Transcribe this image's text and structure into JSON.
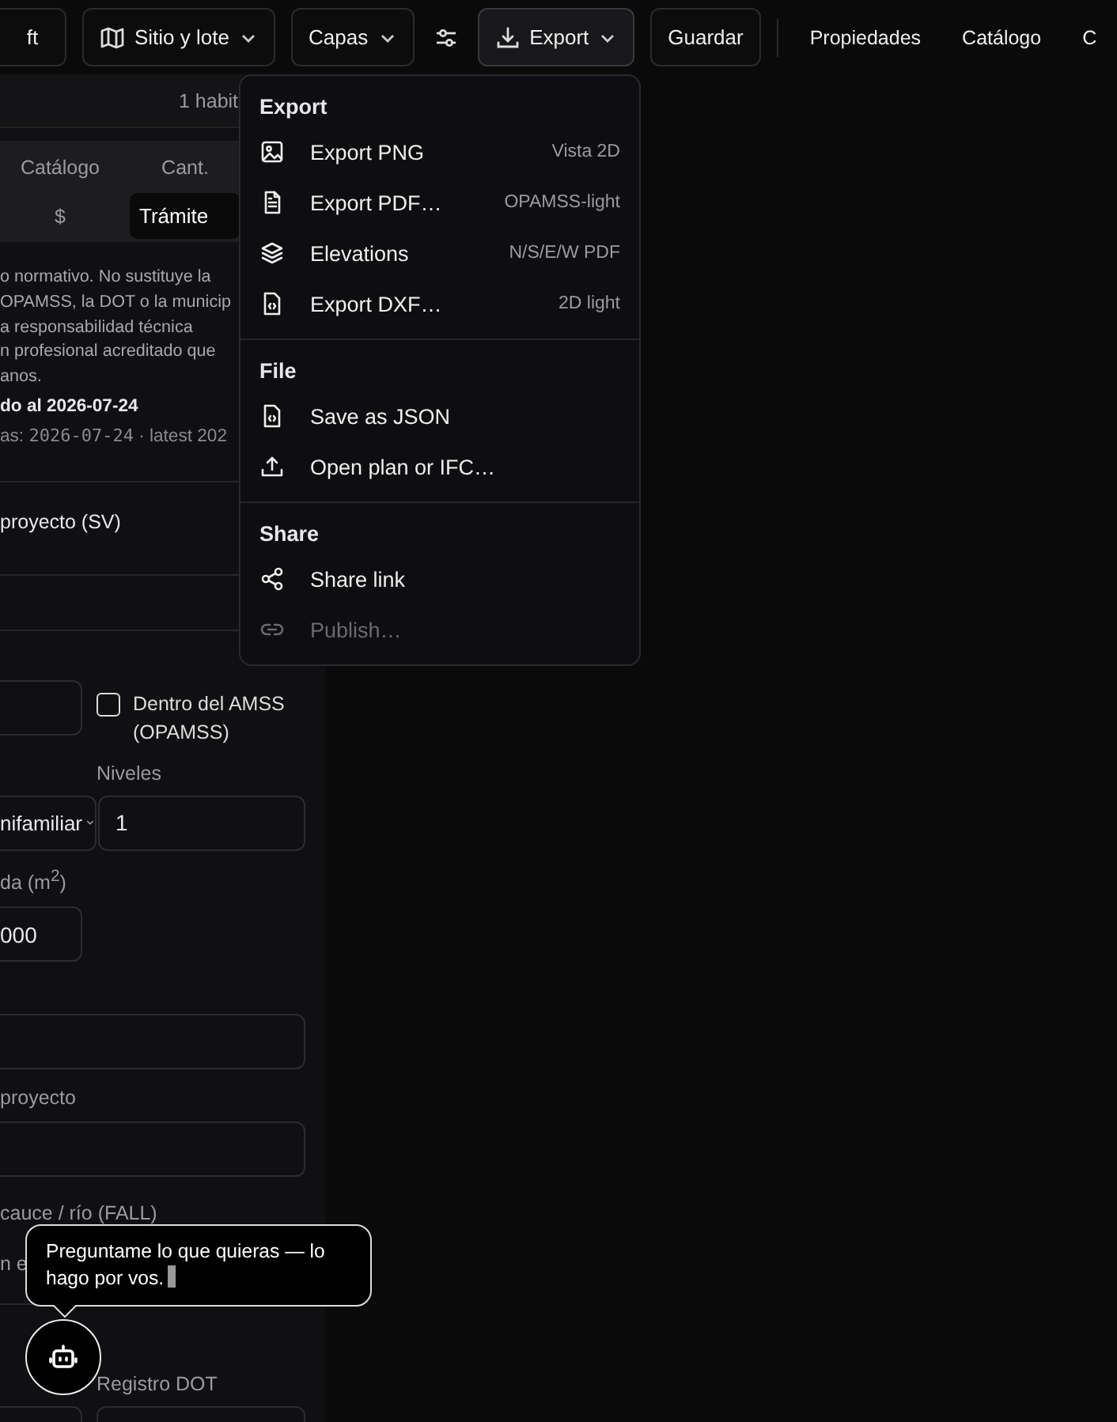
{
  "toolbar": {
    "items": [
      {
        "kind": "button",
        "label": "ft"
      },
      {
        "kind": "map-menu",
        "label": "Sitio y lote"
      },
      {
        "kind": "menu",
        "label": "Capas"
      },
      {
        "kind": "sliders"
      },
      {
        "kind": "export-menu",
        "label": "Export",
        "expanded": true
      },
      {
        "kind": "button",
        "label": "Guardar"
      }
    ],
    "links": [
      {
        "label": "Propiedades"
      },
      {
        "label": "Catálogo"
      },
      {
        "label": "C"
      }
    ]
  },
  "panel": {
    "summary": "1 habit",
    "tabs": [
      {
        "label": "Catálogo",
        "selected": false
      },
      {
        "label": "Cant.",
        "selected": false
      },
      {
        "label": "$",
        "selected": false
      },
      {
        "label": "Trámite",
        "selected": true
      }
    ],
    "notice": "o normativo. No sustituye la\nOPAMSS, la DOT o la municip\na responsabilidad técnica\nn profesional acreditado que\nanos.",
    "updated": "do al 2026-07-24",
    "dates_label": "as:",
    "dates_value": "2026-07-24",
    "dates_tail": "· latest 202",
    "section": "proyecto (SV)",
    "opamss": {
      "label": "Dentro del AMSS (OPAMSS)",
      "checked": false
    },
    "levels_label": "Niveles",
    "use_value": "nifamiliar",
    "levels_value": "1",
    "area_label": "da (m$^{2}$)",
    "area_value": "000",
    "project_label": "proyecto",
    "river_label": "cauce / río (FALL)",
    "cut_label": "n e",
    "dot_label": "Registro DOT"
  },
  "menu": {
    "sections": [
      {
        "title": "Export",
        "items": [
          {
            "kind": "image",
            "label": "Export PNG",
            "hint": "Vista 2D",
            "disabled": false
          },
          {
            "kind": "file-text",
            "label": "Export PDF…",
            "hint": "OPAMSS-light",
            "disabled": false
          },
          {
            "kind": "layers",
            "label": "Elevations",
            "hint": "N/S/E/W PDF",
            "disabled": false
          },
          {
            "kind": "file-code",
            "label": "Export DXF…",
            "hint": "2D light",
            "disabled": false
          }
        ]
      },
      {
        "title": "File",
        "items": [
          {
            "kind": "file-code",
            "label": "Save as JSON",
            "disabled": false
          },
          {
            "kind": "upload",
            "label": "Open plan or IFC…",
            "disabled": false
          }
        ]
      },
      {
        "title": "Share",
        "items": [
          {
            "kind": "share",
            "label": "Share link",
            "disabled": false
          },
          {
            "kind": "link",
            "label": "Publish…",
            "disabled": true
          }
        ]
      }
    ]
  },
  "assistant": {
    "tooltip": "Preguntame lo que quieras — lo hago por vos."
  }
}
